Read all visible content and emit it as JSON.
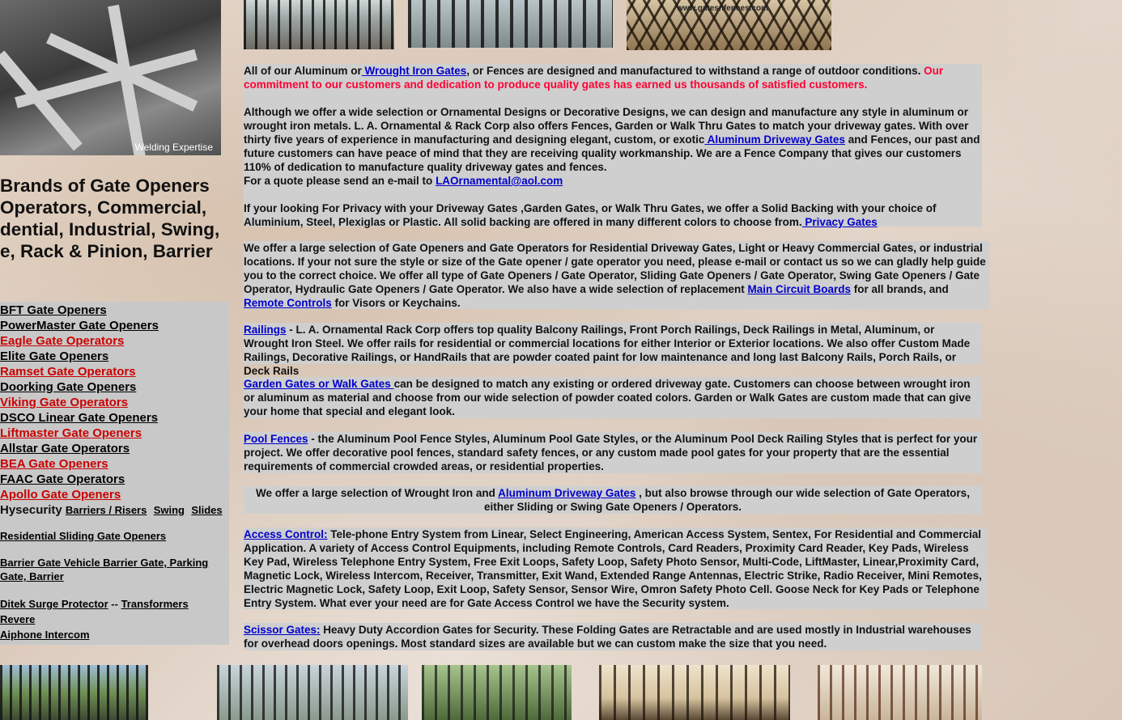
{
  "welding_caption": "Welding Expertise",
  "watermark": "www.gatesnfences.com",
  "brands_title": "Brands of Gate Openers Operators, Commercial, dential, Industrial, Swing, e, Rack & Pinion, Barrier",
  "brands": [
    {
      "label": "BFT Gate Openers",
      "red": false
    },
    {
      "label": "PowerMaster Gate Openers",
      "red": false
    },
    {
      "label": "Eagle Gate Operators",
      "red": true
    },
    {
      "label": "Elite Gate Openers",
      "red": false
    },
    {
      "label": "Ramset Gate Operators",
      "red": true
    },
    {
      "label": "Doorking Gate Openers",
      "red": false
    },
    {
      "label": "Viking Gate Operators",
      "red": true
    },
    {
      "label": "DSCO Linear Gate Openers",
      "red": false
    },
    {
      "label": "Liftmaster Gate Openers",
      "red": true
    },
    {
      "label": "Allstar Gate Operators",
      "red": false
    },
    {
      "label": "BEA Gate Openers",
      "red": true
    },
    {
      "label": "FAAC Gate Operators",
      "red": false
    },
    {
      "label": "Apollo Gate Openers",
      "red": true
    }
  ],
  "hysecurity": {
    "brand": "Hysecurity",
    "links": [
      "Barriers / Risers",
      "Swing",
      "Slides"
    ]
  },
  "residential_sliding": "Residential Sliding Gate Openers",
  "barrier_gate": "Barrier Gate Vehicle Barrier Gate, Parking Gate, Barrier",
  "ditek": "Ditek Surge Protector",
  "ditek_sep": "--",
  "transformers": "Transformers",
  "revere": "Revere",
  "aiphone": "Aiphone Intercom",
  "p1": {
    "a": "All of our Aluminum or",
    "link": " Wrought Iron Gates",
    "b": ", or Fences are designed and manufactured to withstand a range of outdoor conditions.",
    "red": " Our commitment to our customers and dedication to produce quality gates has earned us thousands of satisfied customers."
  },
  "p2": {
    "a": "Although we offer a wide selection or Ornamental Designs or Decorative Designs, we can design and manufacture any style in aluminum or wrought iron metals. L. A. Ornamental & Rack Corp also offers Fences, Garden or Walk Thru Gates to match your driveway  gates. With over thirty five years of experience in manufacturing and designing elegant, custom, or exotic",
    "link": " Aluminum Driveway Gates",
    "b": " and Fences, our past and future customers can have peace of mind that they are receiving quality workmanship.  We are a Fence Company that gives our customers 110% of dedication to manufacture quality driveway gates and fences."
  },
  "p3": {
    "a": "For a quote please send an e-mail to ",
    "link": "LAOrnamental@aol.com"
  },
  "p4": {
    "a": "If your looking For Privacy with your Driveway Gates ,Garden Gates, or Walk Thru Gates, we offer a Solid Backing with your choice of Aluminium, Steel, Plexiglas or Plastic.  All solid backing are offered in many different colors to choose from.",
    "link": " Privacy Gates"
  },
  "p5": {
    "a": "We offer a large selection of  Gate Openers and Gate Operators for Residential Driveway Gates, Light or Heavy Commercial Gates, or industrial locations. If your not sure the style or size of the Gate opener / gate operator  you need, please e-mail or contact us so we can gladly help guide you to the correct choice. We offer all type of Gate Openers / Gate Operator, Sliding Gate Openers / Gate Operator, Swing Gate Openers / Gate Operator, Hydraulic Gate Openers / Gate Operator. We also have a wide selection of replacement ",
    "link1": "Main Circuit Boards",
    "b": " for all brands, and ",
    "link2": "Remote Controls",
    "c": "  for Visors or Keychains."
  },
  "p6": {
    "link": "Railings",
    "a": " - L. A. Ornamental Rack Corp offers top quality Balcony Railings, Front Porch Railings, Deck Railings in Metal, Aluminum, or Wrought Iron Steel.  We offer rails for residential or commercial locations for either Interior or Exterior locations. We also offer Custom Made Railings, Decorative Railings, or HandRails that are powder coated paint for low maintenance and long last Balcony Rails, Porch Rails, or Deck Rails"
  },
  "p7": {
    "link": "Garden Gates or Walk Gates ",
    "a": "can be designed to match any existing or ordered driveway gate.  Customers can choose between wrought iron or aluminum as material  and choose from our wide selection of powder coated colors.  Garden or Walk Gates are custom made that can give your home that special and elegant look."
  },
  "p8": {
    "link": "Pool Fences",
    "a": " - the  Aluminum Pool Fence Styles, Aluminum Pool Gate Styles, or the Aluminum Pool Deck Railing Styles that is perfect for your project. We offer decorative pool fences, standard safety fences, or any custom made pool gates for your property that are the essential requirements of commercial crowded areas, or residential properties."
  },
  "p9": {
    "a": "We offer a large selection of Wrought Iron and ",
    "link": "Aluminum Driveway Gates",
    "b": " , but also browse through our wide selection of Gate Operators, either Sliding or Swing Gate Openers / Operators."
  },
  "p10": {
    "link": "Access Control:",
    "a": "   Tele-phone Entry System from Linear, Select Engineering, American Access System, Sentex, For Residential and Commercial Application.   A variety of Access Control Equipments, including Remote Controls, Card Readers, Proximity Card Reader, Key Pads, Wireless Key Pad, Wireless Telephone Entry System, Free Exit Loops, Safety Loop, Safety Photo Sensor,  Multi-Code, LiftMaster, Linear,Proximity Card, Magnetic Lock,  Wireless Intercom,  Receiver, Transmitter, Exit Wand, Extended Range Antennas, Electric Strike, Radio Receiver, Mini Remotes, Electric Magnetic Lock, Safety Loop, Exit Loop, Safety Sensor, Sensor Wire,  Omron Safety Photo Cell.   Goose Neck for Key Pads or Telephone Entry System. What ever your need are for Gate Access Control we have the Security system."
  },
  "p11": {
    "link": "Scissor Gates:",
    "a": "   Heavy Duty Accordion Gates for Security.  These Folding Gates are Retractable and are used mostly in Industrial warehouses for overhead doors openings. Most standard sizes are available but we can custom make the size that you need."
  }
}
